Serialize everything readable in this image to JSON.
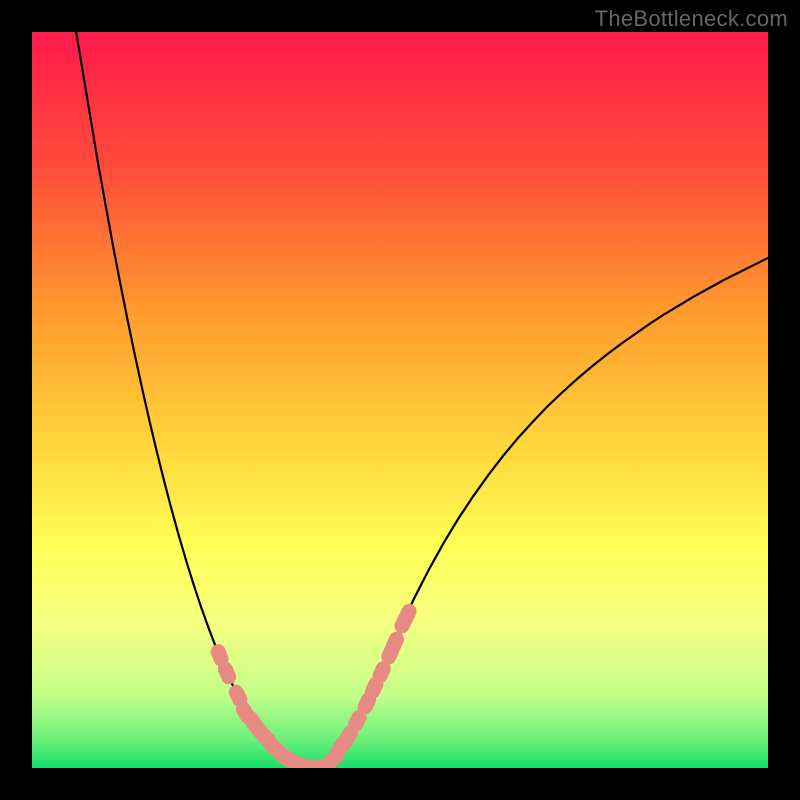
{
  "watermark": "TheBottleneck.com",
  "chart_data": {
    "type": "line",
    "title": "",
    "xlabel": "",
    "ylabel": "",
    "xlim": [
      0,
      100
    ],
    "ylim": [
      0,
      100
    ],
    "grid": false,
    "legend": false,
    "gradient": {
      "stops": [
        {
          "offset": 0,
          "color": "#ff1a4d"
        },
        {
          "offset": 0.18,
          "color": "#ff4b3a"
        },
        {
          "offset": 0.38,
          "color": "#ff9a2e"
        },
        {
          "offset": 0.55,
          "color": "#ffd23a"
        },
        {
          "offset": 0.7,
          "color": "#ffff55"
        },
        {
          "offset": 0.8,
          "color": "#f6ff80"
        },
        {
          "offset": 0.9,
          "color": "#c4ff8a"
        },
        {
          "offset": 0.96,
          "color": "#6ef07a"
        },
        {
          "offset": 1.0,
          "color": "#14e06a"
        }
      ]
    },
    "series": [
      {
        "name": "curve",
        "stroke": "#000000",
        "stroke_width": 2.2,
        "x": [
          6,
          7,
          8,
          9,
          10,
          11,
          12,
          13,
          14,
          15,
          16,
          17,
          18,
          19,
          20,
          21,
          22,
          23,
          24,
          25,
          26,
          27,
          28,
          29,
          30,
          31,
          32,
          33,
          34,
          35,
          36,
          37,
          38,
          39,
          40,
          41,
          42,
          43,
          44,
          45,
          46,
          47,
          48,
          49,
          50,
          52,
          54,
          56,
          58,
          60,
          62,
          64,
          66,
          68,
          70,
          72,
          74,
          76,
          78,
          80,
          82,
          84,
          86,
          88,
          90,
          92,
          94,
          96,
          98,
          100
        ],
        "y": [
          100,
          94,
          88,
          82,
          76.5,
          71,
          65.8,
          60.8,
          56,
          51.4,
          47,
          42.8,
          38.8,
          35,
          31.4,
          28,
          24.8,
          21.8,
          19,
          16.4,
          14,
          11.8,
          9.8,
          8,
          6.4,
          5,
          3.8,
          2.8,
          2,
          1.3,
          0.8,
          0.4,
          0.1,
          0,
          0.4,
          1.3,
          2.6,
          4.2,
          6,
          8,
          10.1,
          12.3,
          14.5,
          16.8,
          19,
          23.2,
          27.1,
          30.7,
          34,
          37,
          39.8,
          42.4,
          44.8,
          47,
          49.1,
          51,
          52.8,
          54.5,
          56.1,
          57.6,
          59,
          60.4,
          61.7,
          62.9,
          64.1,
          65.2,
          66.3,
          67.3,
          68.3,
          69.3
        ]
      }
    ],
    "markers": {
      "fill": "#e78a83",
      "stroke": "#e78a83",
      "r": 7,
      "points": [
        {
          "x": 25.5,
          "y": 15.3
        },
        {
          "x": 26.5,
          "y": 12.9
        },
        {
          "x": 28.0,
          "y": 9.8
        },
        {
          "x": 29.0,
          "y": 7.5
        },
        {
          "x": 30.0,
          "y": 6.3
        },
        {
          "x": 31.0,
          "y": 5.0
        },
        {
          "x": 31.8,
          "y": 4.1
        },
        {
          "x": 33.0,
          "y": 2.7
        },
        {
          "x": 34.5,
          "y": 1.4
        },
        {
          "x": 35.5,
          "y": 0.8
        },
        {
          "x": 36.8,
          "y": 0.3
        },
        {
          "x": 38.2,
          "y": 0.05
        },
        {
          "x": 39.5,
          "y": 0.2
        },
        {
          "x": 41.0,
          "y": 1.3
        },
        {
          "x": 42.0,
          "y": 2.9
        },
        {
          "x": 43.0,
          "y": 4.3
        },
        {
          "x": 44.2,
          "y": 6.4
        },
        {
          "x": 45.5,
          "y": 8.8
        },
        {
          "x": 46.5,
          "y": 10.9
        },
        {
          "x": 47.5,
          "y": 13.0
        },
        {
          "x": 48.7,
          "y": 15.6
        },
        {
          "x": 49.3,
          "y": 17.0
        },
        {
          "x": 50.5,
          "y": 19.8
        },
        {
          "x": 51.0,
          "y": 20.8
        }
      ]
    }
  }
}
